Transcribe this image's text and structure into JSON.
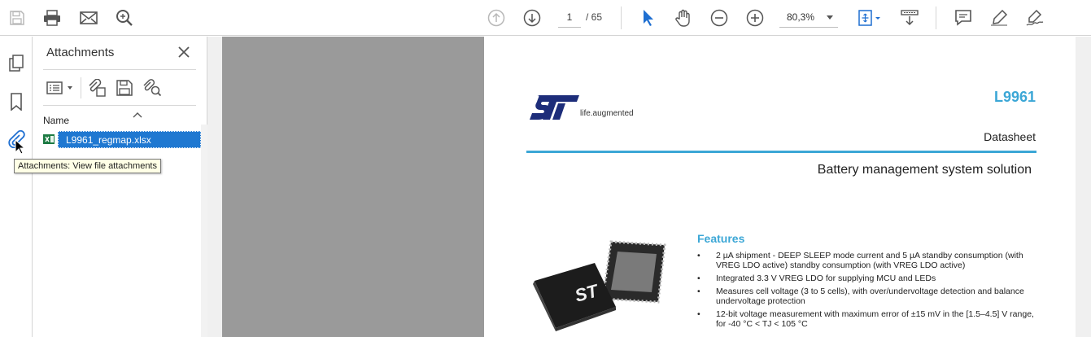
{
  "toolbar": {
    "page_current": "1",
    "page_total": "/ 65",
    "zoom": "80,3%"
  },
  "attachments_panel": {
    "title": "Attachments",
    "column_name": "Name",
    "file": "L9961_regmap.xlsx"
  },
  "tooltip": "Attachments: View file attachments",
  "document": {
    "logo_tagline": "life.augmented",
    "doc_id": "L9961",
    "doc_type": "Datasheet",
    "subtitle": "Battery management system solution",
    "features_heading": "Features",
    "features": [
      "2 µA shipment - DEEP SLEEP mode current and 5 µA standby consumption (with VREG LDO active) standby consumption (with VREG LDO active)",
      "Integrated 3.3 V VREG LDO for supplying MCU and LEDs",
      "Measures cell voltage (3 to 5 cells), with over/undervoltage detection and balance undervoltage protection",
      "12-bit voltage measurement with maximum error of ±15 mV in the [1.5–4.5] V range, for -40 °C < TJ < 105 °C"
    ]
  },
  "colors": {
    "accent": "#3ca7d6",
    "selection": "#1f78d1",
    "st_logo": "#1d2d7a"
  }
}
